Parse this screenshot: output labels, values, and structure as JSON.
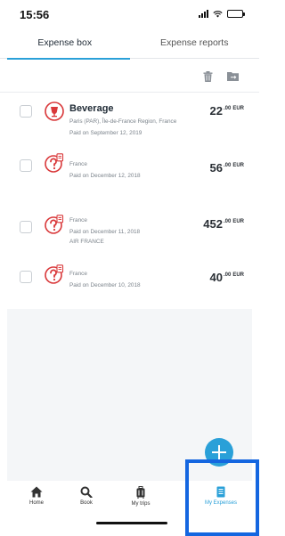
{
  "status_bar": {
    "time": "15:56",
    "icons": [
      "signal-icon",
      "wifi-icon",
      "battery-icon"
    ]
  },
  "tabs": [
    {
      "label": "Expense box",
      "active": true
    },
    {
      "label": "Expense reports",
      "active": false
    }
  ],
  "toolbar": {
    "icons": [
      "trash-icon",
      "folder-move-icon"
    ]
  },
  "expenses": [
    {
      "title": "Beverage",
      "lines": [
        "Paris (PAR), Île-de-France Region, France",
        "Paid on September 12, 2019"
      ],
      "amount": "22",
      "cents": ".00",
      "currency": "EUR",
      "icon": "beverage-icon"
    },
    {
      "title": "",
      "lines": [
        "France",
        "Paid on December 12, 2018"
      ],
      "amount": "56",
      "cents": ".00",
      "currency": "EUR",
      "icon": "unknown-receipt-icon"
    },
    {
      "title": "",
      "lines": [
        "France",
        "Paid on December 11, 2018",
        "AIR FRANCE"
      ],
      "amount": "452",
      "cents": ".00",
      "currency": "EUR",
      "icon": "unknown-receipt-icon"
    },
    {
      "title": "",
      "lines": [
        "France",
        "Paid on December 10, 2018"
      ],
      "amount": "40",
      "cents": ".00",
      "currency": "EUR",
      "icon": "unknown-receipt-icon"
    }
  ],
  "bottom_nav": [
    {
      "label": "Home",
      "icon": "home-icon",
      "active": false
    },
    {
      "label": "Book",
      "icon": "search-icon",
      "active": false
    },
    {
      "label": "My trips",
      "icon": "suitcase-icon",
      "active": false
    },
    {
      "label": "My Expenses",
      "icon": "expenses-icon",
      "active": true
    }
  ],
  "colors": {
    "accent": "#2aa0d8",
    "highlight": "#1466e0",
    "icon_red": "#d9383a",
    "background_empty": "#f4f6f8"
  }
}
